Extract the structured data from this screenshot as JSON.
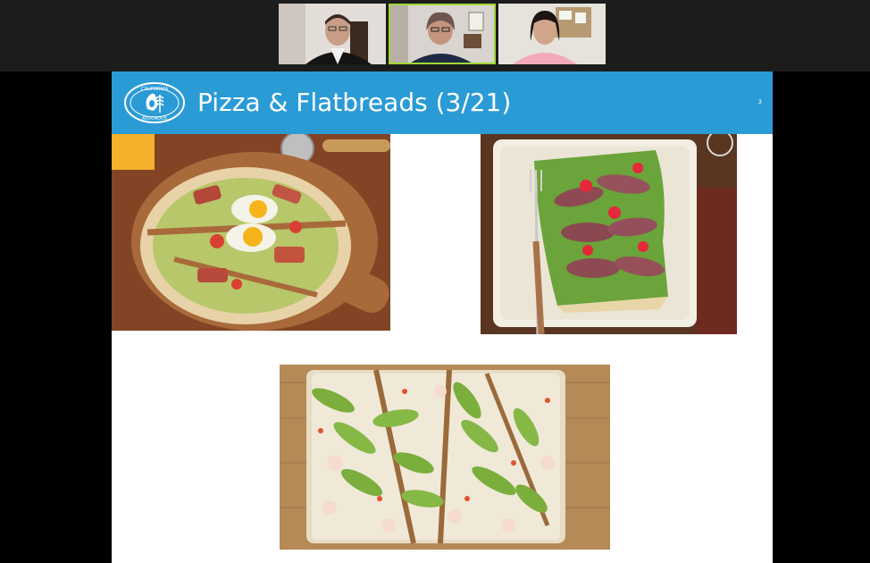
{
  "meeting": {
    "participants": [
      {
        "id": "participant-1",
        "active": false
      },
      {
        "id": "participant-2",
        "active": true
      },
      {
        "id": "participant-3",
        "active": false
      }
    ]
  },
  "slide": {
    "brand_logo_text_top": "CALIFORNIA",
    "brand_logo_text_bottom": "AVOCADOS",
    "title": "Pizza & Flatbreads (3/21)",
    "page_number": "3",
    "header_color": "#2b9bd6",
    "photos": [
      {
        "subject": "breakfast pizza with egg, bacon and guacamole on wooden board"
      },
      {
        "subject": "avocado flatbread with steak and red pepper on white plate"
      },
      {
        "subject": "shrimp and sliced avocado flatbread on wooden board"
      }
    ]
  }
}
